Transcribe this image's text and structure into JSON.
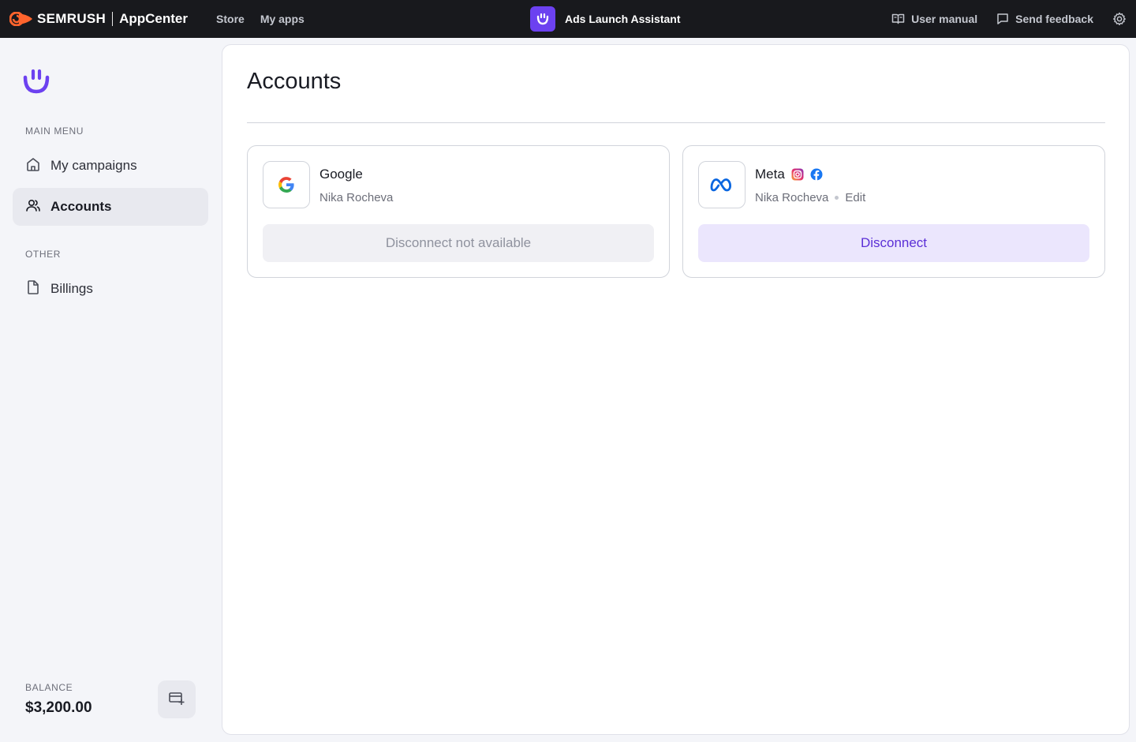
{
  "topbar": {
    "brand_name": "SEMRUSH",
    "brand_app": "AppCenter",
    "nav": [
      "Store",
      "My apps"
    ],
    "app_title": "Ads Launch Assistant",
    "user_manual": "User manual",
    "send_feedback": "Send feedback"
  },
  "sidebar": {
    "main_menu_label": "MAIN MENU",
    "items": [
      {
        "label": "My campaigns",
        "icon": "home-icon"
      },
      {
        "label": "Accounts",
        "icon": "users-icon",
        "active": true
      }
    ],
    "other_label": "OTHER",
    "other_items": [
      {
        "label": "Billings",
        "icon": "document-icon"
      }
    ],
    "balance_label": "BALANCE",
    "balance_value": "$3,200.00"
  },
  "main": {
    "title": "Accounts",
    "cards": [
      {
        "name": "Google",
        "owner": "Nika Rocheva",
        "button": "Disconnect not available",
        "button_state": "disabled"
      },
      {
        "name": "Meta",
        "owner": "Nika Rocheva",
        "edit": "Edit",
        "button": "Disconnect",
        "button_state": "enabled",
        "platform_icons": [
          "instagram-icon",
          "facebook-icon"
        ]
      }
    ]
  },
  "colors": {
    "accent": "#6c41f0",
    "topbar_bg": "#18191d",
    "semrush_orange": "#ff642d",
    "button_soft": "#ebe6fd"
  }
}
